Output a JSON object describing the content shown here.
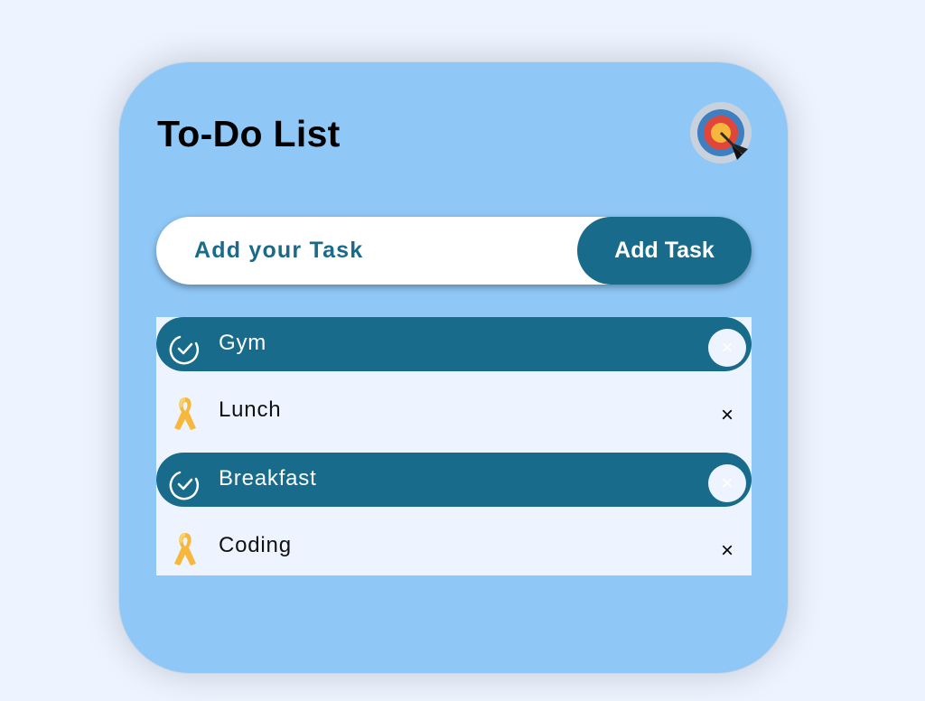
{
  "app": {
    "title": "To-Do List",
    "header_icon": "target-dart-icon"
  },
  "input": {
    "placeholder": "Add your Task",
    "value": ""
  },
  "add_button": {
    "label": "Add Task"
  },
  "tasks": [
    {
      "label": "Gym",
      "completed": true,
      "icon": "check-circle-icon",
      "remove_label": "×"
    },
    {
      "label": "Lunch",
      "completed": false,
      "icon": "ribbon-icon",
      "remove_label": "×"
    },
    {
      "label": "Breakfast",
      "completed": true,
      "icon": "check-circle-icon",
      "remove_label": "×"
    },
    {
      "label": "Coding",
      "completed": false,
      "icon": "ribbon-icon",
      "remove_label": "×"
    }
  ],
  "colors": {
    "page_background": "#edf4ff",
    "card_background": "#8fc8f7",
    "accent": "#186b8a",
    "input_text": "#1a6a8a",
    "ribbon": "#f6b73c"
  }
}
